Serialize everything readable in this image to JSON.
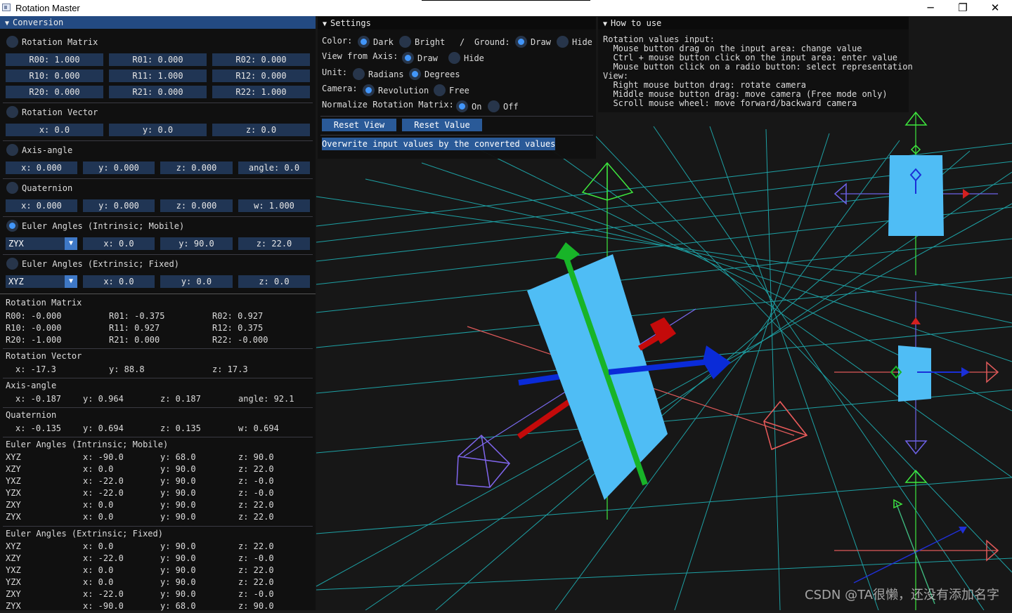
{
  "window": {
    "title": "Rotation Master",
    "min_glyph": "─",
    "max_glyph": "❐",
    "close_glyph": "✕"
  },
  "conversion": {
    "title": "Conversion",
    "matrix": {
      "label": "Rotation Matrix",
      "cells": [
        "R00: 1.000",
        "R01: 0.000",
        "R02: 0.000",
        "R10: 0.000",
        "R11: 1.000",
        "R12: 0.000",
        "R20: 0.000",
        "R21: 0.000",
        "R22: 1.000"
      ]
    },
    "rotvec": {
      "label": "Rotation Vector",
      "cells": [
        "x: 0.0",
        "y: 0.0",
        "z: 0.0"
      ]
    },
    "axisangle": {
      "label": "Axis-angle",
      "cells": [
        "x: 0.000",
        "y: 0.000",
        "z: 0.000",
        "angle: 0.0"
      ]
    },
    "quat": {
      "label": "Quaternion",
      "cells": [
        "x: 0.000",
        "y: 0.000",
        "z: 0.000",
        "w: 1.000"
      ]
    },
    "euler_in": {
      "label": "Euler Angles (Intrinsic; Mobile)",
      "order": "ZYX",
      "cells": [
        "x: 0.0",
        "y: 90.0",
        "z: 22.0"
      ]
    },
    "euler_ex": {
      "label": "Euler Angles (Extrinsic; Fixed)",
      "order": "XYZ",
      "cells": [
        "x: 0.0",
        "y: 0.0",
        "z: 0.0"
      ]
    },
    "out_matrix": {
      "label": "Rotation Matrix",
      "cells": [
        "R00: -0.000",
        "R01: -0.375",
        "R02: 0.927",
        "R10: -0.000",
        "R11: 0.927",
        "R12: 0.375",
        "R20: -1.000",
        "R21: 0.000",
        "R22: -0.000"
      ]
    },
    "out_rotvec": {
      "label": "Rotation Vector",
      "cells": [
        "x: -17.3",
        "y: 88.8",
        "z: 17.3"
      ]
    },
    "out_axisangle": {
      "label": "Axis-angle",
      "cells": [
        "x: -0.187",
        "y: 0.964",
        "z: 0.187",
        "angle: 92.1"
      ]
    },
    "out_quat": {
      "label": "Quaternion",
      "cells": [
        "x: -0.135",
        "y: 0.694",
        "z: 0.135",
        "w: 0.694"
      ]
    },
    "out_euler_in": {
      "label": "Euler Angles (Intrinsic; Mobile)",
      "rows": [
        [
          "XYZ",
          "x: -90.0",
          "y: 68.0",
          "z: 90.0"
        ],
        [
          "XZY",
          "x: 0.0",
          "y: 90.0",
          "z: 22.0"
        ],
        [
          "YXZ",
          "x: -22.0",
          "y: 90.0",
          "z: -0.0"
        ],
        [
          "YZX",
          "x: -22.0",
          "y: 90.0",
          "z: -0.0"
        ],
        [
          "ZXY",
          "x: 0.0",
          "y: 90.0",
          "z: 22.0"
        ],
        [
          "ZYX",
          "x: 0.0",
          "y: 90.0",
          "z: 22.0"
        ]
      ]
    },
    "out_euler_ex": {
      "label": "Euler Angles (Extrinsic; Fixed)",
      "rows": [
        [
          "XYZ",
          "x: 0.0",
          "y: 90.0",
          "z: 22.0"
        ],
        [
          "XZY",
          "x: -22.0",
          "y: 90.0",
          "z: -0.0"
        ],
        [
          "YXZ",
          "x: 0.0",
          "y: 90.0",
          "z: 22.0"
        ],
        [
          "YZX",
          "x: 0.0",
          "y: 90.0",
          "z: 22.0"
        ],
        [
          "ZXY",
          "x: -22.0",
          "y: 90.0",
          "z: -0.0"
        ],
        [
          "ZYX",
          "x: -90.0",
          "y: 68.0",
          "z: 90.0"
        ]
      ]
    }
  },
  "settings": {
    "title": "Settings",
    "color_label": "Color:",
    "dark": "Dark",
    "bright": "Bright",
    "slash": "/",
    "ground_label": "Ground:",
    "ground_draw": "Draw",
    "ground_hide": "Hide",
    "view_axis_label": "View from Axis:",
    "view_draw": "Draw",
    "view_hide": "Hide",
    "unit_label": "Unit:",
    "radians": "Radians",
    "degrees": "Degrees",
    "camera_label": "Camera:",
    "revolution": "Revolution",
    "free": "Free",
    "normalize_label": "Normalize Rotation Matrix:",
    "on": "On",
    "off": "Off",
    "reset_view": "Reset View",
    "reset_value": "Reset Value",
    "overwrite": "Overwrite input values by the converted values"
  },
  "howto": {
    "title": "How to use",
    "lines": [
      "Rotation values input:",
      "  Mouse button drag on the input area: change value",
      "  Ctrl + mouse button click on the input area: enter value",
      "  Mouse button click on a radio button: select representation",
      "View:",
      "  Right mouse button drag: rotate camera",
      "  Middle mouse button drag: move camera (Free mode only)",
      "  Scroll mouse wheel: move forward/backward camera"
    ]
  },
  "watermark": "CSDN @TA很懒，还没有添加名字",
  "colors": {
    "accent": "#4296fa",
    "frame": "#203554",
    "button": "#2a5a98",
    "header": "#234a82",
    "grid": "#1fb9bd",
    "object": "#4fbdf5"
  }
}
